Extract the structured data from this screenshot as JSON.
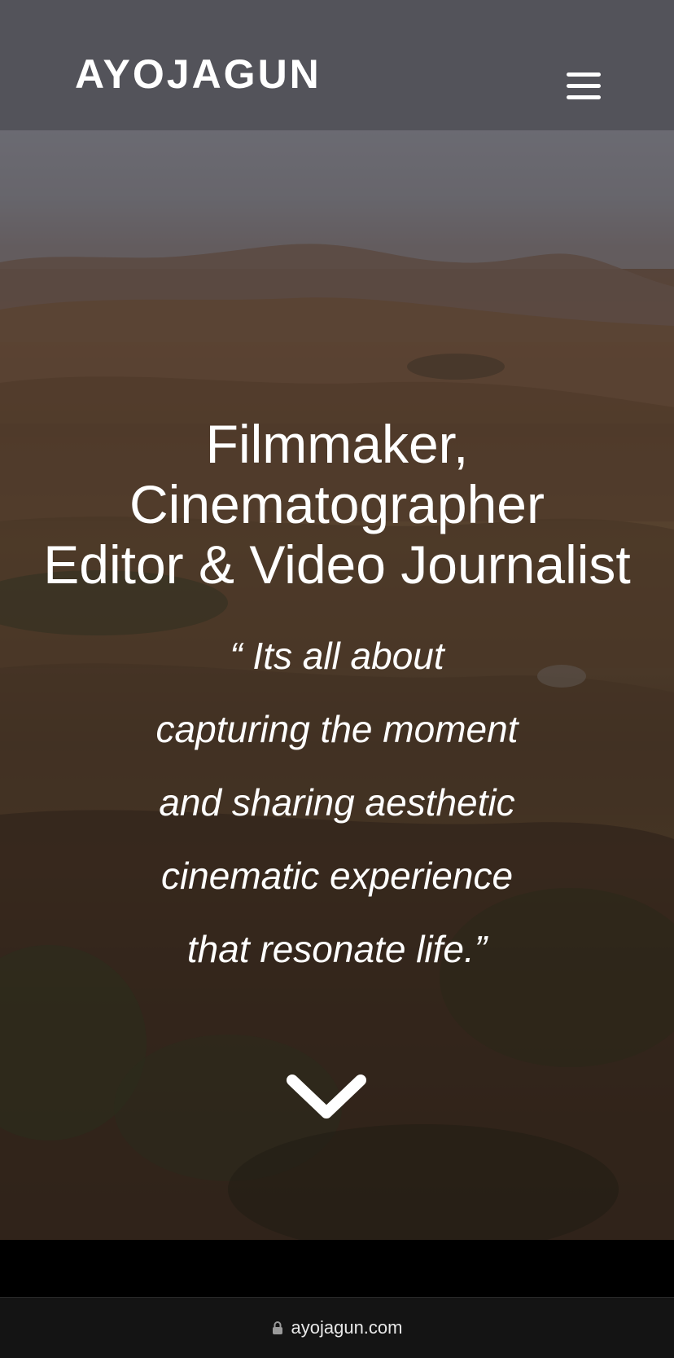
{
  "header": {
    "brand": "AYOJAGUN",
    "menu_icon": "hamburger-menu-icon"
  },
  "hero": {
    "headline_lines": [
      "Filmmaker,",
      "Cinematographer",
      "Editor & Video Journalist"
    ],
    "quote_lines": [
      "“ Its all about",
      "capturing the moment",
      "and sharing aesthetic",
      "cinematic experience",
      "that resonate life.”"
    ],
    "scroll_icon": "chevron-down-icon"
  },
  "browser": {
    "url": "ayojagun.com",
    "lock_icon": "lock-icon"
  },
  "colors": {
    "header_bg": "#505056",
    "text": "#ffffff",
    "url_bar_bg": "#141414"
  }
}
